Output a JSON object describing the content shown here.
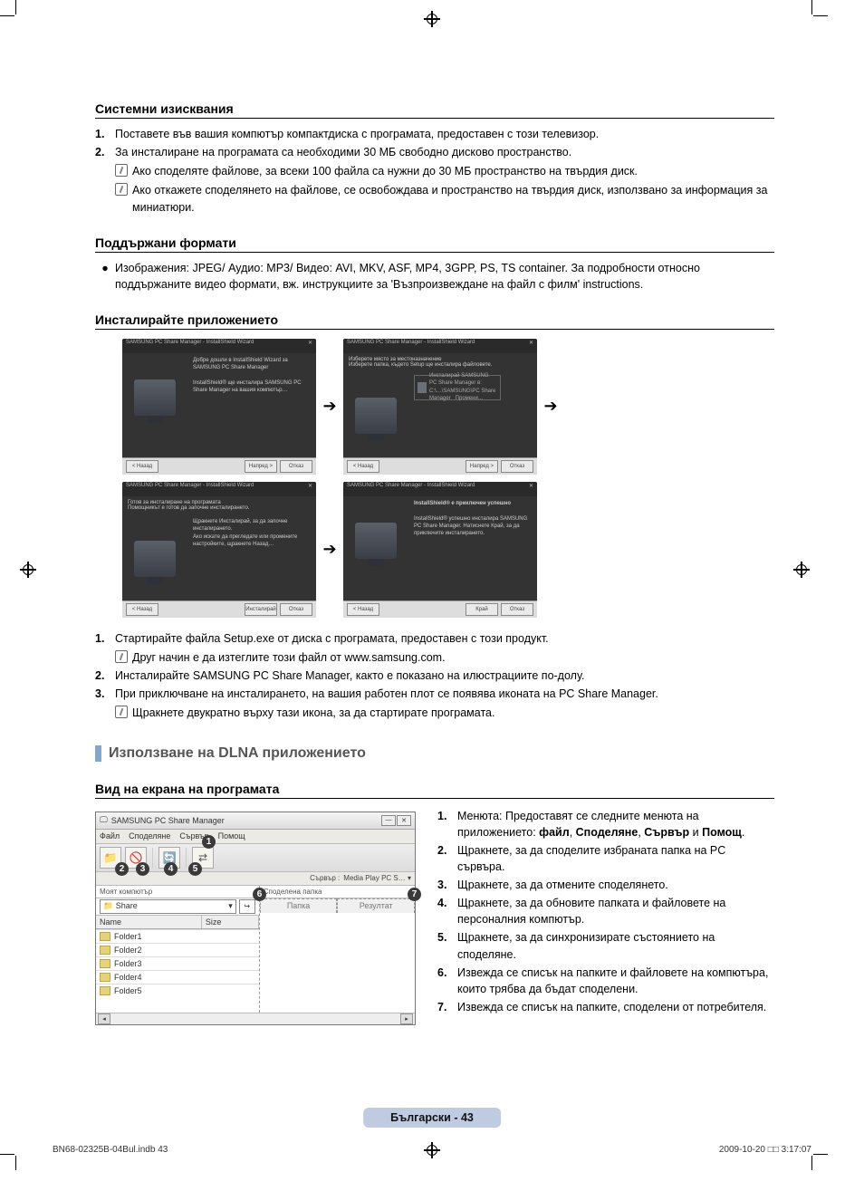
{
  "sections": {
    "sys_req": {
      "title": "Системни изисквания",
      "items": [
        {
          "text": "Поставете във вашия компютър компактдиска с програмата, предоставен с този телевизор."
        },
        {
          "text": "За инсталиране на програмата са необходими 30 МБ свободно дисково пространство.",
          "notes": [
            "Ако споделяте файлове, за всеки 100 файла са нужни до 30 МБ пространство на твърдия диск.",
            "Ако откажете споделянето на файлове, се освобождава и пространство на твърдия диск, използвано за информация за миниатюри."
          ]
        }
      ]
    },
    "formats": {
      "title": "Поддържани формати",
      "bullet": "Изображения: JPEG/ Аудио: MP3/ Видео: AVI, MKV, ASF, MP4, 3GPP, PS, TS container. За подробности относно поддържаните видео формати, вж. инструкциите за 'Възпроизвеждане на файл с филм' instructions."
    },
    "install": {
      "title": "Инсталирайте приложението",
      "wizard_title": "SAMSUNG PC Share Manager - InstallShield Wizard",
      "steps": [
        {
          "text": "Стартирайте файла Setup.exe от диска с програмата, предоставен с този продукт.",
          "notes": [
            "Друг начин е да изтеглите този файл от www.samsung.com."
          ]
        },
        {
          "text": "Инсталирайте SAMSUNG PC Share Manager, както е показано на илюстрациите по-долу."
        },
        {
          "text": "При приключване на инсталирането, на вашия работен плот се появява иконата на PC Share Manager.",
          "notes": [
            "Щракнете двукратно върху тази икона, за да стартирате програмата."
          ]
        }
      ]
    },
    "dlna_use": "Използване на DLNA приложението",
    "view": {
      "title": "Вид на екрана на програмата",
      "app_title": "SAMSUNG PC Share Manager",
      "menus": [
        "Файл",
        "Споделяне",
        "Сървър",
        "Помощ"
      ],
      "server_label": "Сървър :",
      "server_value": "Media Play PC S… ▾",
      "my_computer": "Моят компютър",
      "share_label": "Share",
      "col_name": "Name",
      "col_size": "Size",
      "folders": [
        "Folder1",
        "Folder2",
        "Folder3",
        "Folder4",
        "Folder5"
      ],
      "shared_folder": "Споделена папка",
      "tab_folder": "Папка",
      "tab_result": "Резултат",
      "legend": [
        "Менюта: Предоставят се следните менюта на приложението: файл, Споделяне, Сървър и Помощ.",
        "Щракнете, за да споделите избраната папка на PC сървъра.",
        "Щракнете, за да отмените споделянето.",
        "Щракнете, за да обновите папката и файловете на персоналния компютър.",
        "Щракнете, за да синхронизирате състоянието на споделяне.",
        "Извежда се списък на папките и файловете на компютъра, които трябва да бъдат споделени.",
        "Извежда се списък на папките, споделени от потребителя."
      ]
    }
  },
  "footer": {
    "lang_page": "Български - 43",
    "doc": "BN68-02325B-04Bul.indb   43",
    "stamp": "2009-10-20   □□ 3:17:07"
  }
}
